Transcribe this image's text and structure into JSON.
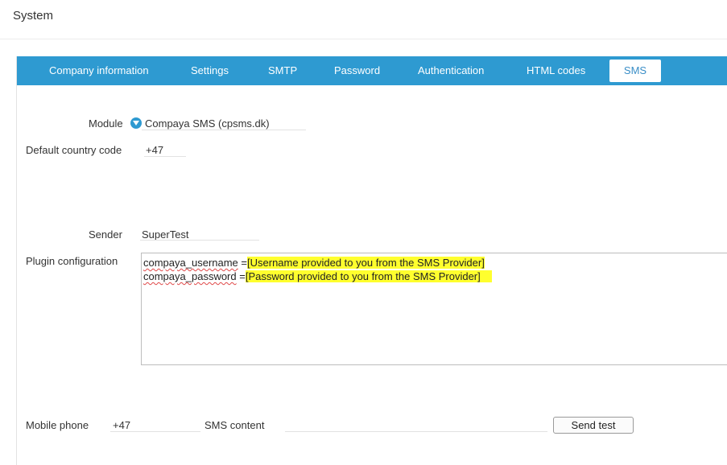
{
  "header": {
    "title": "System"
  },
  "tabs": [
    {
      "label": "Company information",
      "active": false
    },
    {
      "label": "Settings",
      "active": false
    },
    {
      "label": "SMTP",
      "active": false
    },
    {
      "label": "Password",
      "active": false
    },
    {
      "label": "Authentication",
      "active": false
    },
    {
      "label": "HTML codes",
      "active": false
    },
    {
      "label": "SMS",
      "active": true
    }
  ],
  "form": {
    "module": {
      "label": "Module",
      "value": "Compaya SMS (cpsms.dk)",
      "icon": "chevron-down-circle-icon"
    },
    "country_code": {
      "label": "Default country code",
      "value": "+47"
    },
    "sender": {
      "label": "Sender",
      "value": "SuperTest"
    },
    "plugin": {
      "label": "Plugin configuration",
      "lines": [
        {
          "key": "compaya_username",
          "eq": " =",
          "value": "[Username provided to you from the SMS Provider]"
        },
        {
          "key": "compaya_password",
          "eq": " =",
          "value": "[Password provided to you from the SMS Provider]"
        }
      ]
    },
    "mobile": {
      "label": "Mobile phone",
      "value": "+47"
    },
    "sms_content": {
      "label": "SMS content",
      "value": ""
    },
    "send_test": {
      "label": "Send test"
    }
  },
  "colors": {
    "accent": "#2e9ad1",
    "highlight": "#ffff2e",
    "active_tab_text": "#3a8ec7"
  }
}
